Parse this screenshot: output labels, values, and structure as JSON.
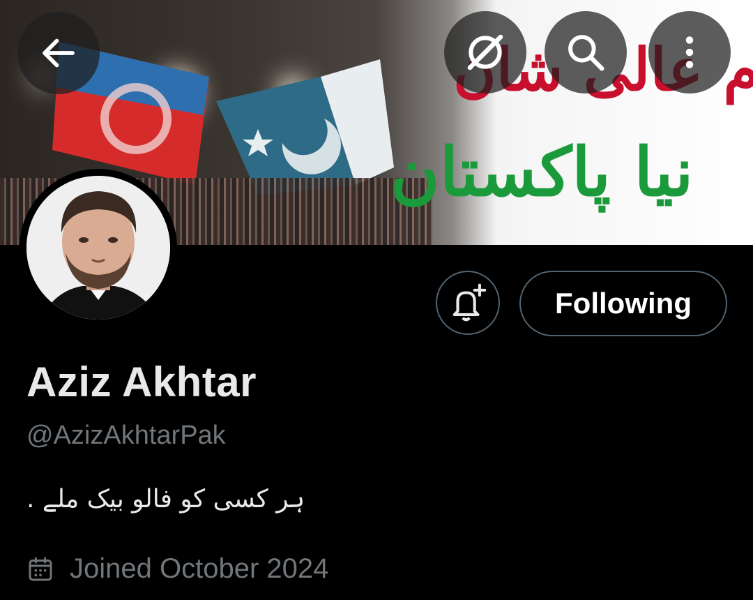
{
  "banner": {
    "urdu_line1": "عزم عالی شان",
    "urdu_line2": "نیا پاکستان"
  },
  "top_bar": {
    "back": "back-arrow-icon",
    "grok": "grok-icon",
    "search": "search-icon",
    "more": "more-vertical-icon"
  },
  "profile": {
    "display_name": "Aziz Akhtar",
    "handle": "@AzizAkhtarPak",
    "bio": "ہر کسی کو فالو بیک ملے .",
    "joined": "Joined October 2024"
  },
  "actions": {
    "notify_icon": "bell-plus-icon",
    "follow_label": "Following"
  },
  "colors": {
    "background": "#000000",
    "primary_text": "#e7e9ea",
    "secondary_text": "#71767b",
    "button_border": "#536471",
    "slogan_red": "#c8102e",
    "slogan_green": "#1a9a3a"
  }
}
